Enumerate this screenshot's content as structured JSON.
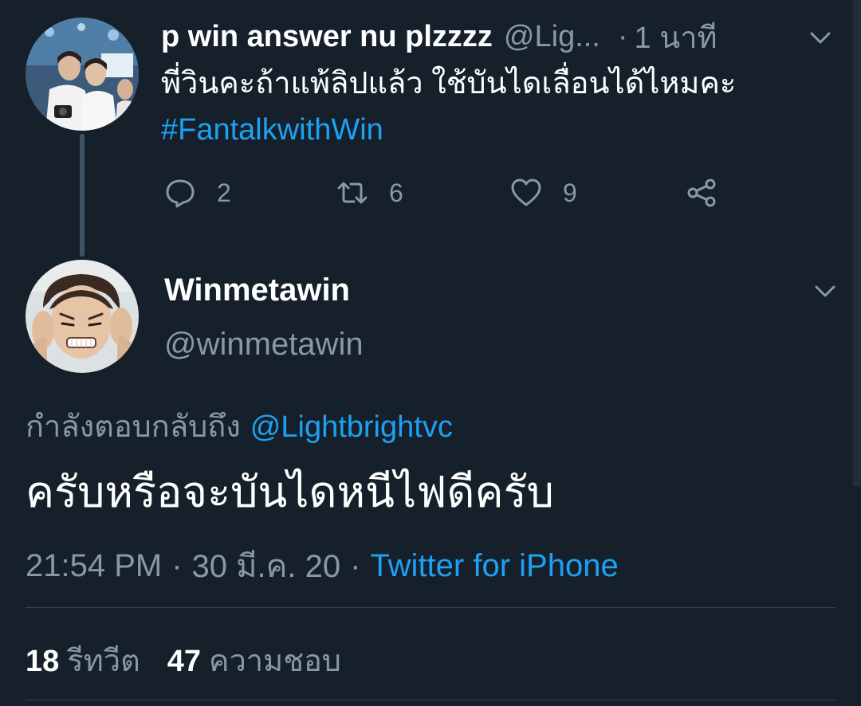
{
  "colors": {
    "background": "#15202b",
    "accent": "#1da1f2",
    "secondary_text": "#8899a6",
    "primary_text": "#ffffff"
  },
  "tweet1": {
    "display_name": "p win answer nu plzzzz",
    "handle": "@Lig...",
    "dot": "·",
    "time": "1 นาที",
    "text": "พี่วินคะถ้าแพ้ลิปแล้ว ใช้บันไดเลื่อนได้ไหมคะ",
    "hashtag": "#FantalkwithWin",
    "actions": {
      "reply_count": "2",
      "retweet_count": "6",
      "like_count": "9"
    }
  },
  "tweet2": {
    "display_name": "Winmetawin",
    "handle": "@winmetawin",
    "reply_prefix": "กำลังตอบกลับถึง",
    "reply_mention": "@Lightbrightvc",
    "text": "ครับหรือจะบันไดหนีไฟดีครับ",
    "time": "21:54 PM",
    "date": "30 มี.ค. 20",
    "separator": "·",
    "source": "Twitter for iPhone",
    "retweets_count": "18",
    "retweets_label": "รีทวีต",
    "likes_count": "47",
    "likes_label": "ความชอบ"
  },
  "icons": [
    "reply-icon",
    "retweet-icon",
    "heart-icon",
    "share-icon",
    "chevron-down-icon"
  ]
}
